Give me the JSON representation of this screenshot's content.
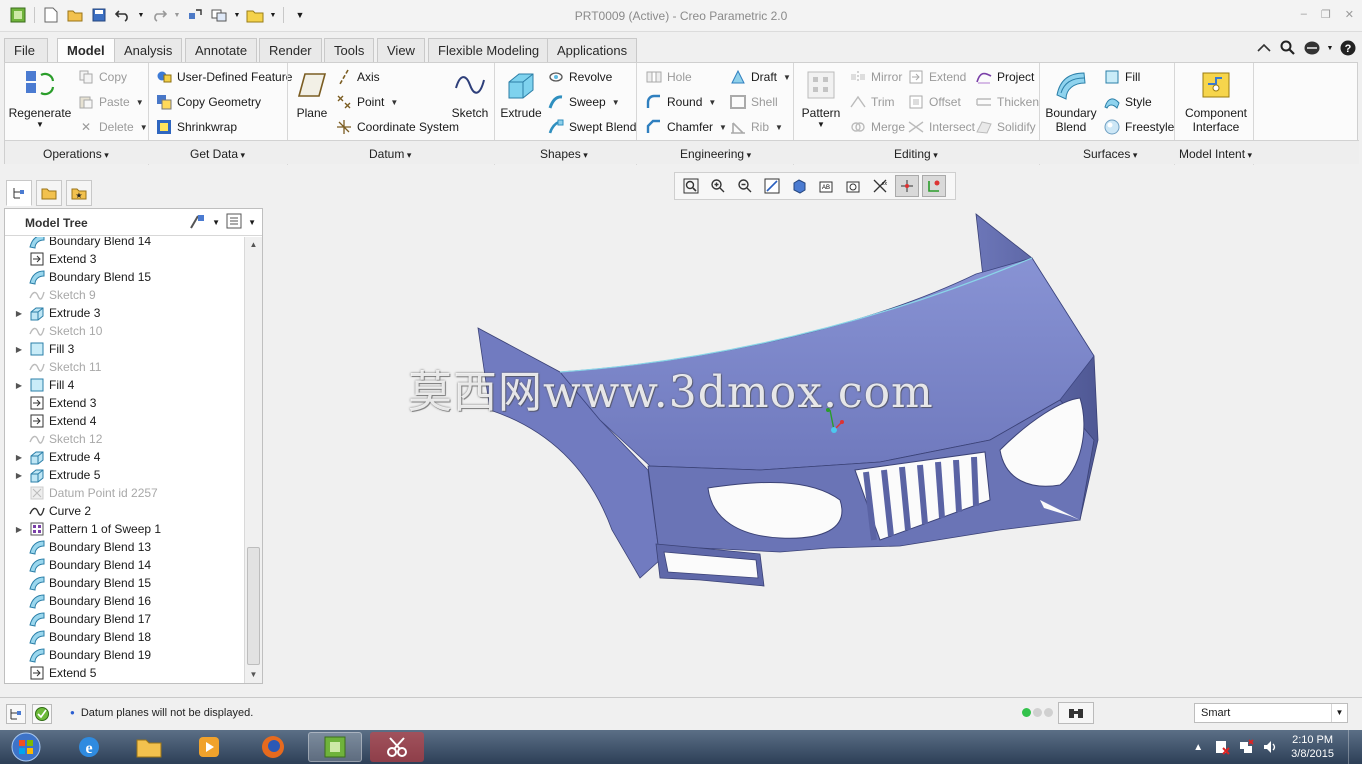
{
  "window": {
    "title": "PRT0009 (Active) - Creo Parametric 2.0",
    "controls": [
      "–",
      "❐",
      "✕"
    ]
  },
  "tabs": [
    "File",
    "Model",
    "Analysis",
    "Annotate",
    "Render",
    "Tools",
    "View",
    "Flexible Modeling",
    "Applications"
  ],
  "active_tab": "Model",
  "ribbon": {
    "operations": {
      "regenerate": "Regenerate",
      "copy": "Copy",
      "paste": "Paste",
      "delete": "Delete",
      "group": "Operations"
    },
    "get_data": {
      "udf": "User-Defined Feature",
      "copy_geometry": "Copy Geometry",
      "shrinkwrap": "Shrinkwrap",
      "group": "Get Data"
    },
    "datum": {
      "plane": "Plane",
      "axis": "Axis",
      "point": "Point",
      "csys": "Coordinate System",
      "sketch": "Sketch",
      "group": "Datum"
    },
    "shapes": {
      "extrude": "Extrude",
      "revolve": "Revolve",
      "sweep": "Sweep",
      "swept_blend": "Swept Blend",
      "group": "Shapes"
    },
    "engineering": {
      "hole": "Hole",
      "round": "Round",
      "chamfer": "Chamfer",
      "draft": "Draft",
      "shell": "Shell",
      "rib": "Rib",
      "group": "Engineering"
    },
    "editing": {
      "pattern": "Pattern",
      "mirror": "Mirror",
      "trim": "Trim",
      "merge": "Merge",
      "extend": "Extend",
      "offset": "Offset",
      "intersect": "Intersect",
      "project": "Project",
      "thicken": "Thicken",
      "solidify": "Solidify",
      "group": "Editing"
    },
    "surfaces": {
      "boundary_blend": "Boundary Blend",
      "fill": "Fill",
      "style": "Style",
      "freestyle": "Freestyle",
      "group": "Surfaces"
    },
    "model_intent": {
      "component_interface": "Component Interface",
      "group": "Model Intent"
    }
  },
  "model_tree": {
    "title": "Model Tree",
    "items": [
      {
        "label": "Boundary Blend 14",
        "icon": "boundary-blend-icon",
        "expandable": false,
        "disabled": false
      },
      {
        "label": "Extend 3",
        "icon": "extend-icon",
        "expandable": false,
        "disabled": false
      },
      {
        "label": "Boundary Blend 15",
        "icon": "boundary-blend-icon",
        "expandable": false,
        "disabled": false
      },
      {
        "label": "Sketch 9",
        "icon": "sketch-icon",
        "expandable": false,
        "disabled": true
      },
      {
        "label": "Extrude 3",
        "icon": "extrude-icon",
        "expandable": true,
        "disabled": false
      },
      {
        "label": "Sketch 10",
        "icon": "sketch-icon",
        "expandable": false,
        "disabled": true
      },
      {
        "label": "Fill 3",
        "icon": "fill-icon",
        "expandable": true,
        "disabled": false
      },
      {
        "label": "Sketch 11",
        "icon": "sketch-icon",
        "expandable": false,
        "disabled": true
      },
      {
        "label": "Fill 4",
        "icon": "fill-icon",
        "expandable": true,
        "disabled": false
      },
      {
        "label": "Extend 3",
        "icon": "extend-icon",
        "expandable": false,
        "disabled": false
      },
      {
        "label": "Extend 4",
        "icon": "extend-icon",
        "expandable": false,
        "disabled": false
      },
      {
        "label": "Sketch 12",
        "icon": "sketch-icon",
        "expandable": false,
        "disabled": true
      },
      {
        "label": "Extrude 4",
        "icon": "extrude-icon",
        "expandable": true,
        "disabled": false
      },
      {
        "label": "Extrude 5",
        "icon": "extrude-icon",
        "expandable": true,
        "disabled": false
      },
      {
        "label": "Datum Point id 2257",
        "icon": "datum-point-icon",
        "expandable": false,
        "disabled": true
      },
      {
        "label": "Curve 2",
        "icon": "curve-icon",
        "expandable": false,
        "disabled": false
      },
      {
        "label": "Pattern 1 of Sweep 1",
        "icon": "pattern-icon",
        "expandable": true,
        "disabled": false
      },
      {
        "label": "Boundary Blend 13",
        "icon": "boundary-blend-icon",
        "expandable": false,
        "disabled": false
      },
      {
        "label": "Boundary Blend 14",
        "icon": "boundary-blend-icon",
        "expandable": false,
        "disabled": false
      },
      {
        "label": "Boundary Blend 15",
        "icon": "boundary-blend-icon",
        "expandable": false,
        "disabled": false
      },
      {
        "label": "Boundary Blend 16",
        "icon": "boundary-blend-icon",
        "expandable": false,
        "disabled": false
      },
      {
        "label": "Boundary Blend 17",
        "icon": "boundary-blend-icon",
        "expandable": false,
        "disabled": false
      },
      {
        "label": "Boundary Blend 18",
        "icon": "boundary-blend-icon",
        "expandable": false,
        "disabled": false
      },
      {
        "label": "Boundary Blend 19",
        "icon": "boundary-blend-icon",
        "expandable": false,
        "disabled": false
      },
      {
        "label": "Extend 5",
        "icon": "extend-icon",
        "expandable": false,
        "disabled": false
      }
    ]
  },
  "graphics": {
    "watermark": "莫西网www.3dmox.com",
    "model_color": "#7b86cc"
  },
  "status": {
    "message": "Datum planes will not be displayed.",
    "filter": "Smart"
  },
  "taskbar": {
    "time": "2:10 PM",
    "date": "3/8/2015"
  }
}
